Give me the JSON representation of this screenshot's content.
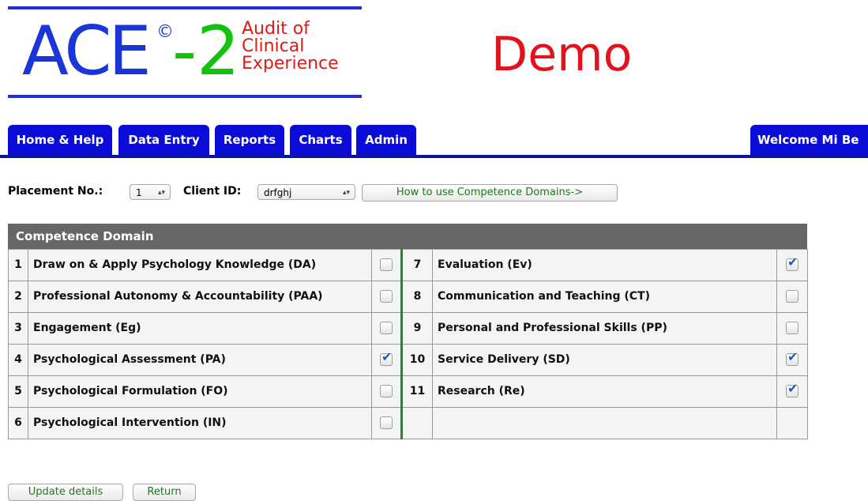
{
  "logo": {
    "ace": "ACE",
    "copyright": "©",
    "dash_two": "-2",
    "subtitle": [
      "Audit of",
      "Clinical",
      "Experience"
    ]
  },
  "demo_label": "Demo",
  "nav": {
    "tabs": [
      "Home & Help",
      "Data Entry",
      "Reports",
      "Charts",
      "Admin"
    ],
    "welcome": "Welcome Mi Be"
  },
  "controls": {
    "placement_label": "Placement No.:",
    "placement_value": "1",
    "client_label": "Client ID:",
    "client_value": "drfghj",
    "howto_button": "How to use Competence Domains->"
  },
  "table": {
    "header": "Competence Domain",
    "rows": [
      {
        "left": {
          "num": "1",
          "label": "Draw on & Apply Psychology Knowledge (DA)",
          "checked": false
        },
        "right": {
          "num": "7",
          "label": "Evaluation (Ev)",
          "checked": true
        }
      },
      {
        "left": {
          "num": "2",
          "label": "Professional Autonomy & Accountability (PAA)",
          "checked": false
        },
        "right": {
          "num": "8",
          "label": "Communication and Teaching (CT)",
          "checked": false
        }
      },
      {
        "left": {
          "num": "3",
          "label": "Engagement (Eg)",
          "checked": false
        },
        "right": {
          "num": "9",
          "label": "Personal and Professional Skills (PP)",
          "checked": false
        }
      },
      {
        "left": {
          "num": "4",
          "label": "Psychological Assessment (PA)",
          "checked": true
        },
        "right": {
          "num": "10",
          "label": "Service Delivery (SD)",
          "checked": true
        }
      },
      {
        "left": {
          "num": "5",
          "label": "Psychological Formulation (FO)",
          "checked": false
        },
        "right": {
          "num": "11",
          "label": "Research (Re)",
          "checked": true
        }
      },
      {
        "left": {
          "num": "6",
          "label": "Psychological Intervention (IN)",
          "checked": false
        },
        "right": null
      }
    ]
  },
  "buttons": {
    "update": "Update details",
    "return": "Return"
  },
  "colors": {
    "logo_blue": "#1a35d8",
    "logo_green": "#12c20e",
    "logo_red": "#e01818",
    "nav_blue": "#0b0bd8",
    "header_grey": "#666666",
    "separator_green": "#1c8a1c"
  }
}
